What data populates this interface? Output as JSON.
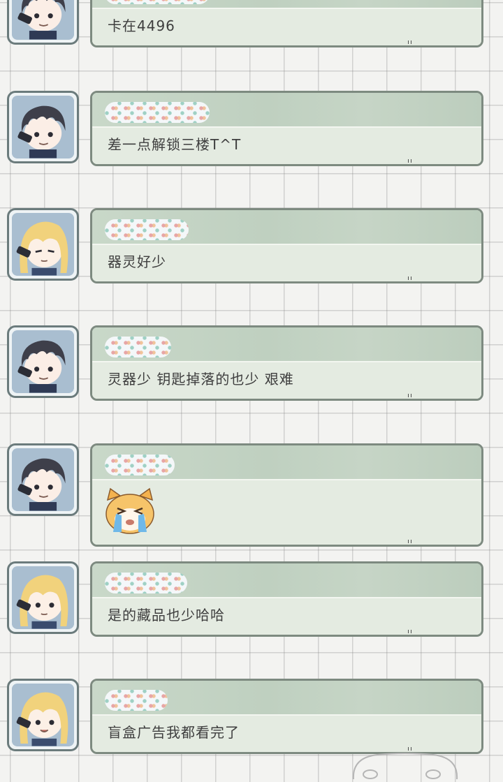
{
  "messages": [
    {
      "avatar": "boy",
      "text": "卡在4496",
      "name_width": 150
    },
    {
      "avatar": "boy",
      "text": "差一点解锁三楼T^T",
      "name_width": 150
    },
    {
      "avatar": "girl",
      "text": "器灵好少",
      "name_width": 120
    },
    {
      "avatar": "boy",
      "text": "灵器少 钥匙掉落的也少 艰难",
      "name_width": 95
    },
    {
      "avatar": "boy",
      "text": "",
      "sticker": "crying-cat-sticker",
      "name_width": 100
    },
    {
      "avatar": "girl",
      "text": "是的藏品也少哈哈",
      "name_width": 118
    },
    {
      "avatar": "girl",
      "text": "盲盒广告我都看完了",
      "name_width": 90
    }
  ],
  "colors": {
    "bubble_border": "#7d8a80",
    "bubble_header": "#c6d5c6",
    "bubble_body": "#e4ebe1",
    "avatar_border": "#6b7b7c",
    "text": "#3e3e3e"
  }
}
